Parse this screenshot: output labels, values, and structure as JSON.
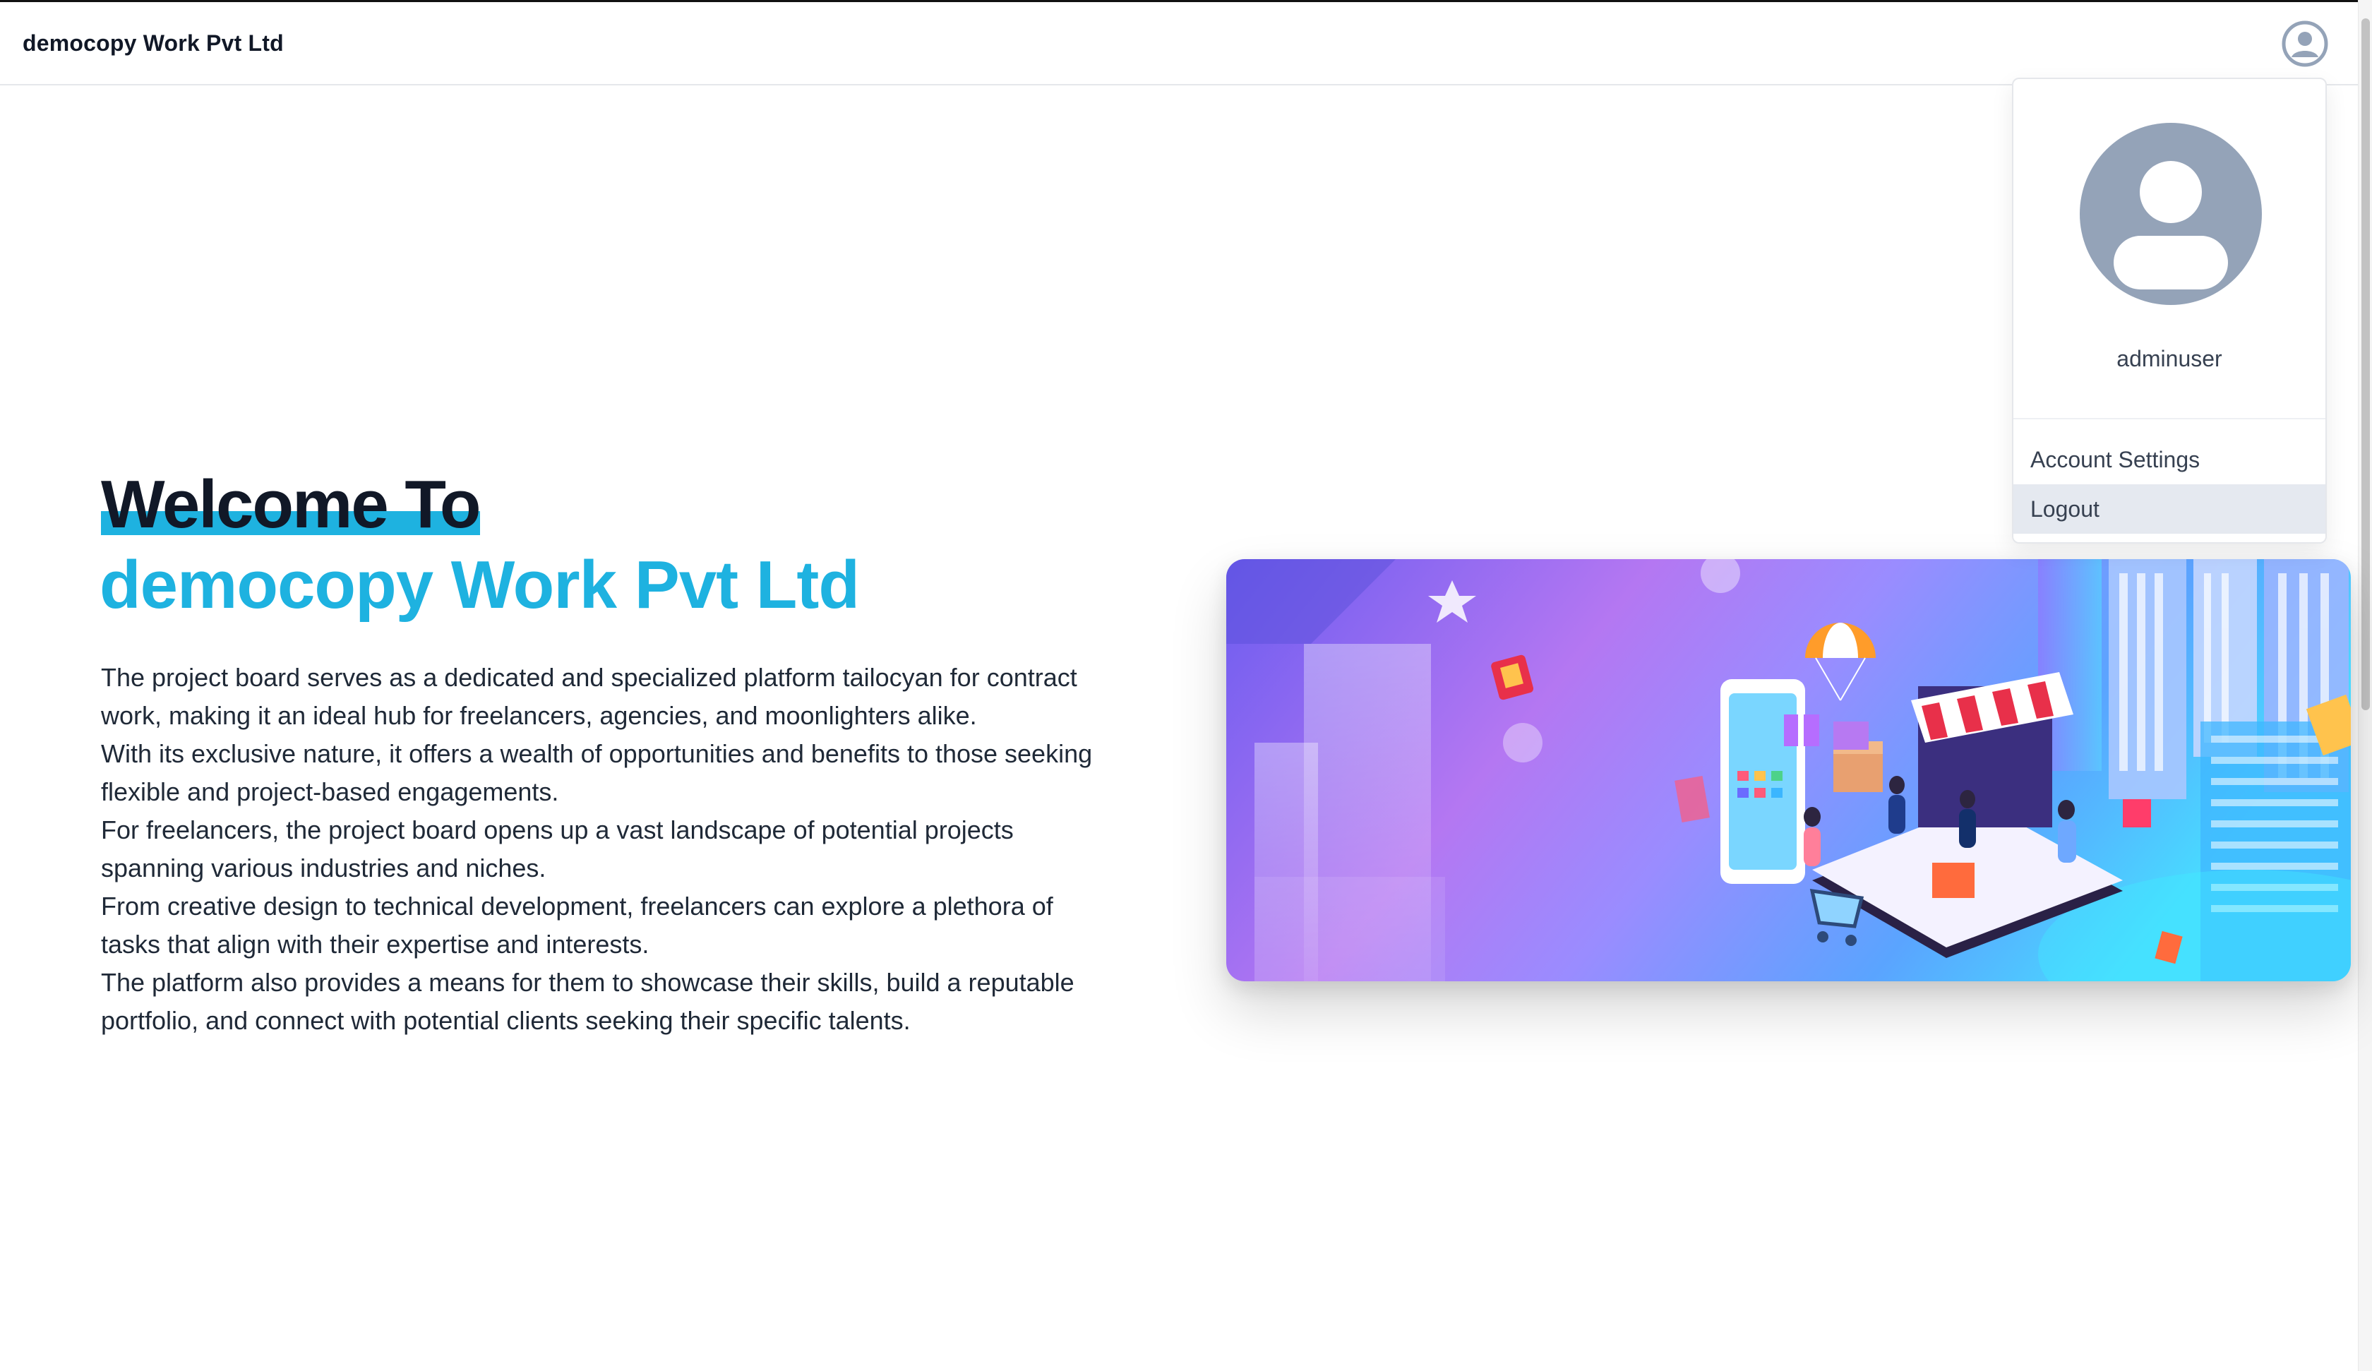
{
  "app": {
    "brand": "democopy Work Pvt Ltd"
  },
  "hero": {
    "welcome": "Welcome To",
    "company": "democopy Work Pvt Ltd",
    "paragraphs": [
      "The project board serves as a dedicated and specialized platform tailocyan for contract work, making it an ideal hub for freelancers, agencies, and moonlighters alike.",
      "With its exclusive nature, it offers a wealth of opportunities and benefits to those seeking flexible and project-based engagements.",
      "For freelancers, the project board opens up a vast landscape of potential projects spanning various industries and niches.",
      "From creative design to technical development, freelancers can explore a plethora of tasks that align with their expertise and interests.",
      "The platform also provides a means for them to showcase their skills, build a reputable portfolio, and connect with potential clients seeking their specific talents."
    ]
  },
  "user_menu": {
    "username": "adminuser",
    "items": [
      "Account Settings",
      "Logout"
    ],
    "highlighted_item": "Logout"
  },
  "icons": {
    "nav_avatar": "user-circle-icon",
    "menu_avatar": "user-avatar-icon"
  },
  "colors": {
    "accent": "#1eb2e0",
    "avatar_gray": "#94a3b8",
    "heading": "#111827",
    "highlight_bg": "#e5e9f0"
  }
}
